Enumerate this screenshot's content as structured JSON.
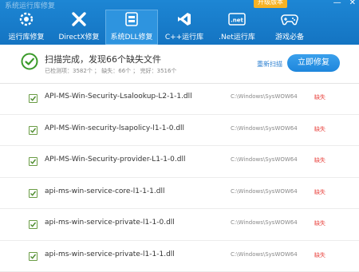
{
  "window": {
    "title": "系统运行库修复",
    "version_badge": "升级版本",
    "controls": [
      "—",
      "✕"
    ]
  },
  "tabs": [
    {
      "label": "运行库修复",
      "icon": "gear-icon"
    },
    {
      "label": "DirectX修复",
      "icon": "directx-icon"
    },
    {
      "label": "系统DLL修复",
      "icon": "dll-icon",
      "active": true
    },
    {
      "label": "C++运行库",
      "icon": "visualstudio-icon"
    },
    {
      "label": ".Net运行库",
      "icon": "net-icon"
    },
    {
      "label": "游戏必备",
      "icon": "gamepad-icon"
    }
  ],
  "summary": {
    "title": "扫描完成，发现66个缺失文件",
    "stats": "已检测项：3582个 ； 缺失：66个 ； 完好：3516个",
    "rescan": "重新扫描",
    "fix_button": "立即修复"
  },
  "files": [
    {
      "name": "API-MS-Win-Security-Lsalookup-L2-1-1.dll",
      "path": "C:\\Windows\\SysWOW64",
      "status": "缺失"
    },
    {
      "name": "API-MS-Win-security-lsapolicy-l1-1-0.dll",
      "path": "C:\\Windows\\SysWOW64",
      "status": "缺失"
    },
    {
      "name": "API-MS-Win-Security-provider-L1-1-0.dll",
      "path": "C:\\Windows\\SysWOW64",
      "status": "缺失"
    },
    {
      "name": "api-ms-win-service-core-l1-1-1.dll",
      "path": "C:\\Windows\\SysWOW64",
      "status": "缺失"
    },
    {
      "name": "api-ms-win-service-private-l1-1-0.dll",
      "path": "C:\\Windows\\SysWOW64",
      "status": "缺失"
    },
    {
      "name": "api-ms-win-service-private-l1-1-1.dll",
      "path": "C:\\Windows\\SysWOW64",
      "status": "缺失"
    }
  ],
  "colors": {
    "toolbar": "#1676c5",
    "accent": "#1e86dc",
    "ok": "#3a9a2a",
    "missing": "#e8403b"
  }
}
